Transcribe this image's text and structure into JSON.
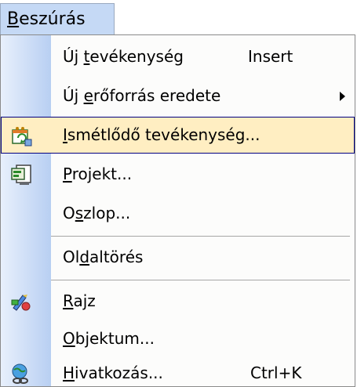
{
  "menu": {
    "title_mnemonic": "B",
    "title_rest": "eszúrás",
    "items": [
      {
        "pre": "Új ",
        "mnemonic": "t",
        "post": "evékenység",
        "shortcut": "Insert"
      },
      {
        "pre": "Új ",
        "mnemonic": "e",
        "post": "rőforrás eredete",
        "shortcut": ""
      },
      {
        "pre": "",
        "mnemonic": "I",
        "post": "smétlődő tevékenység...",
        "shortcut": ""
      },
      {
        "pre": "",
        "mnemonic": "P",
        "post": "rojekt...",
        "shortcut": ""
      },
      {
        "pre": "O",
        "mnemonic": "s",
        "post": "zlop...",
        "shortcut": ""
      },
      {
        "pre": "Ol",
        "mnemonic": "d",
        "post": "altörés",
        "shortcut": ""
      },
      {
        "pre": "",
        "mnemonic": "R",
        "post": "ajz",
        "shortcut": ""
      },
      {
        "pre": "",
        "mnemonic": "O",
        "post": "bjektum...",
        "shortcut": ""
      },
      {
        "pre": "",
        "mnemonic": "H",
        "post": "ivatkozás...",
        "shortcut": "Ctrl+K"
      }
    ]
  },
  "colors": {
    "highlight_fill": "#ffeec2",
    "highlight_border": "#000080",
    "gutter_dark": "#b8cff2",
    "title_fill": "#c5d9f5"
  },
  "icons": {
    "recurring": "recurring-task-icon",
    "project": "insert-project-icon",
    "drawing": "drawing-icon",
    "hyperlink": "hyperlink-icon",
    "submenu": "submenu-arrow-icon"
  }
}
